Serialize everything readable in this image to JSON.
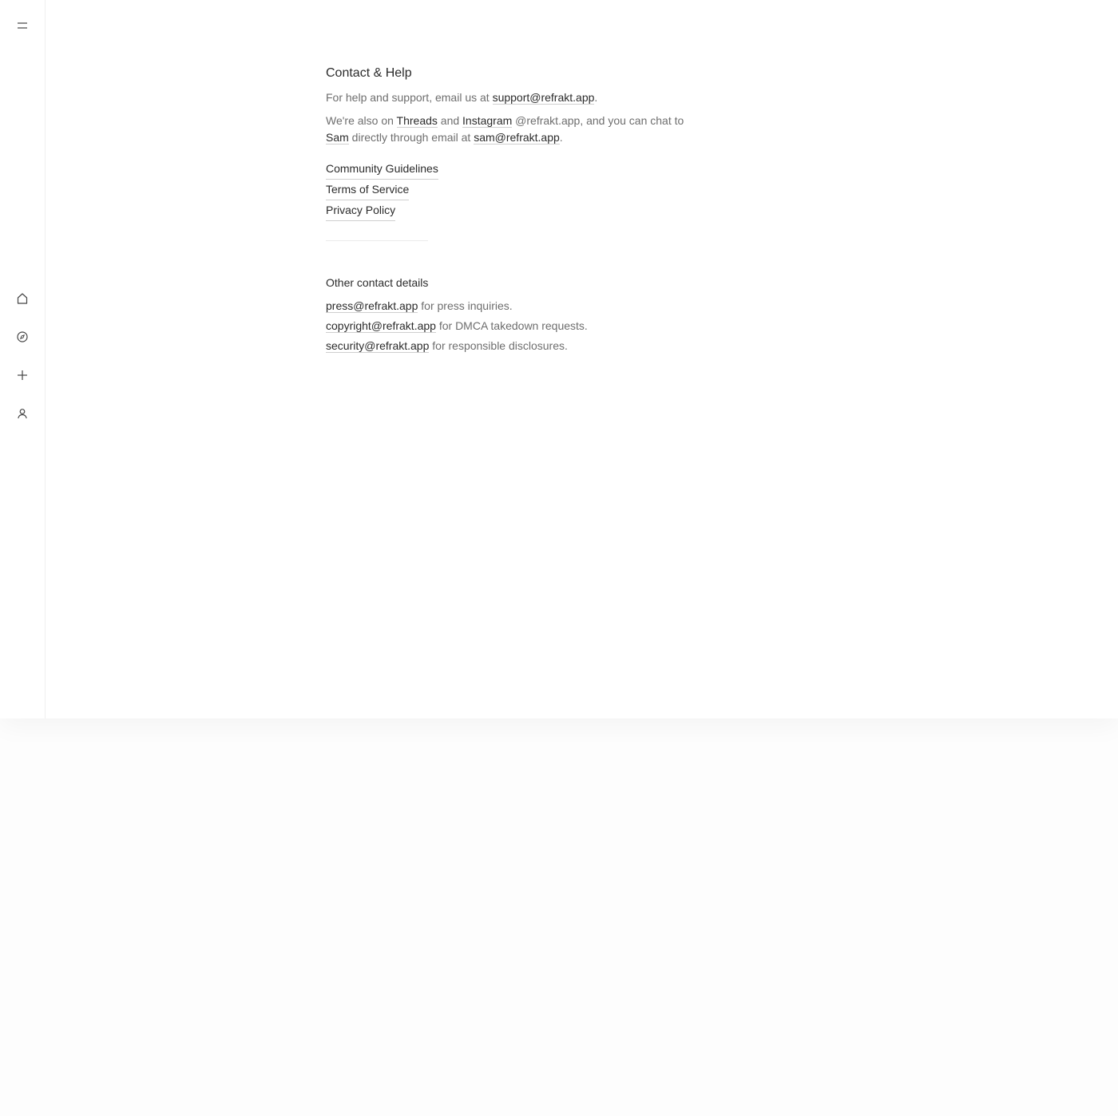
{
  "sidebar": {
    "items": [
      {
        "name": "menu-icon",
        "label": "Menu"
      },
      {
        "name": "home-icon",
        "label": "Home"
      },
      {
        "name": "compass-icon",
        "label": "Explore"
      },
      {
        "name": "plus-icon",
        "label": "Create"
      },
      {
        "name": "user-icon",
        "label": "Profile"
      }
    ]
  },
  "contact": {
    "title": "Contact & Help",
    "support_prefix": "For help and support, email us at ",
    "support_email": "support@refrakt.app",
    "support_suffix": ".",
    "social_prefix": "We're also on ",
    "threads_label": "Threads",
    "and_text": " and ",
    "instagram_label": "Instagram",
    "social_middle": " @refrakt.app, and you can chat to ",
    "sam_label": "Sam",
    "sam_middle": " directly through email at ",
    "sam_email": "sam@refrakt.app",
    "sam_suffix": "."
  },
  "legal": {
    "community_guidelines": "Community Guidelines",
    "terms_of_service": "Terms of Service",
    "privacy_policy": "Privacy Policy"
  },
  "other": {
    "title": "Other contact details",
    "press_email": "press@refrakt.app",
    "press_text": " for press inquiries.",
    "copyright_email": "copyright@refrakt.app",
    "copyright_text": " for DMCA takedown requests.",
    "security_email": "security@refrakt.app",
    "security_text": " for responsible disclosures."
  }
}
